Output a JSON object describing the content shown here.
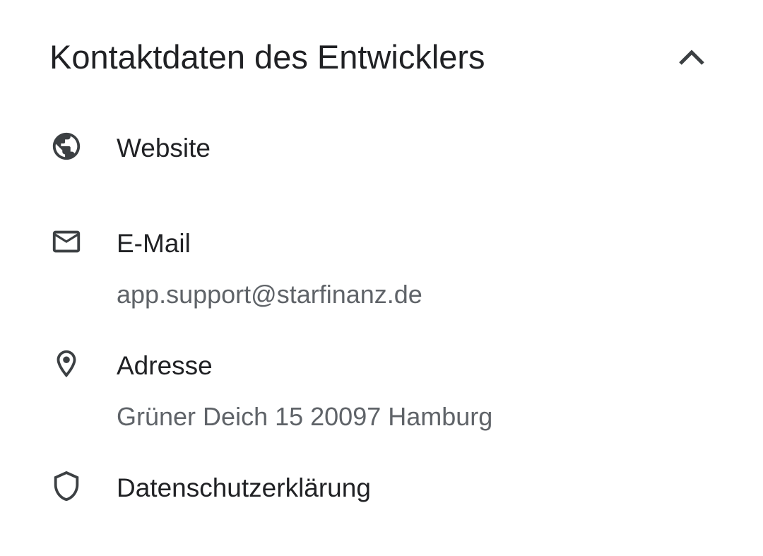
{
  "section": {
    "title": "Kontaktdaten des Entwicklers"
  },
  "items": [
    {
      "icon": "globe-icon",
      "label": "Website"
    },
    {
      "icon": "mail-icon",
      "label": "E-Mail",
      "value": "app.support@starfinanz.de"
    },
    {
      "icon": "location-pin-icon",
      "label": "Adresse",
      "value": "Grüner Deich 15 20097 Hamburg"
    },
    {
      "icon": "shield-icon",
      "label": "Datenschutzerklärung"
    }
  ],
  "colors": {
    "text_primary": "#202124",
    "text_secondary": "#5f6368",
    "icon": "#3c4043"
  }
}
